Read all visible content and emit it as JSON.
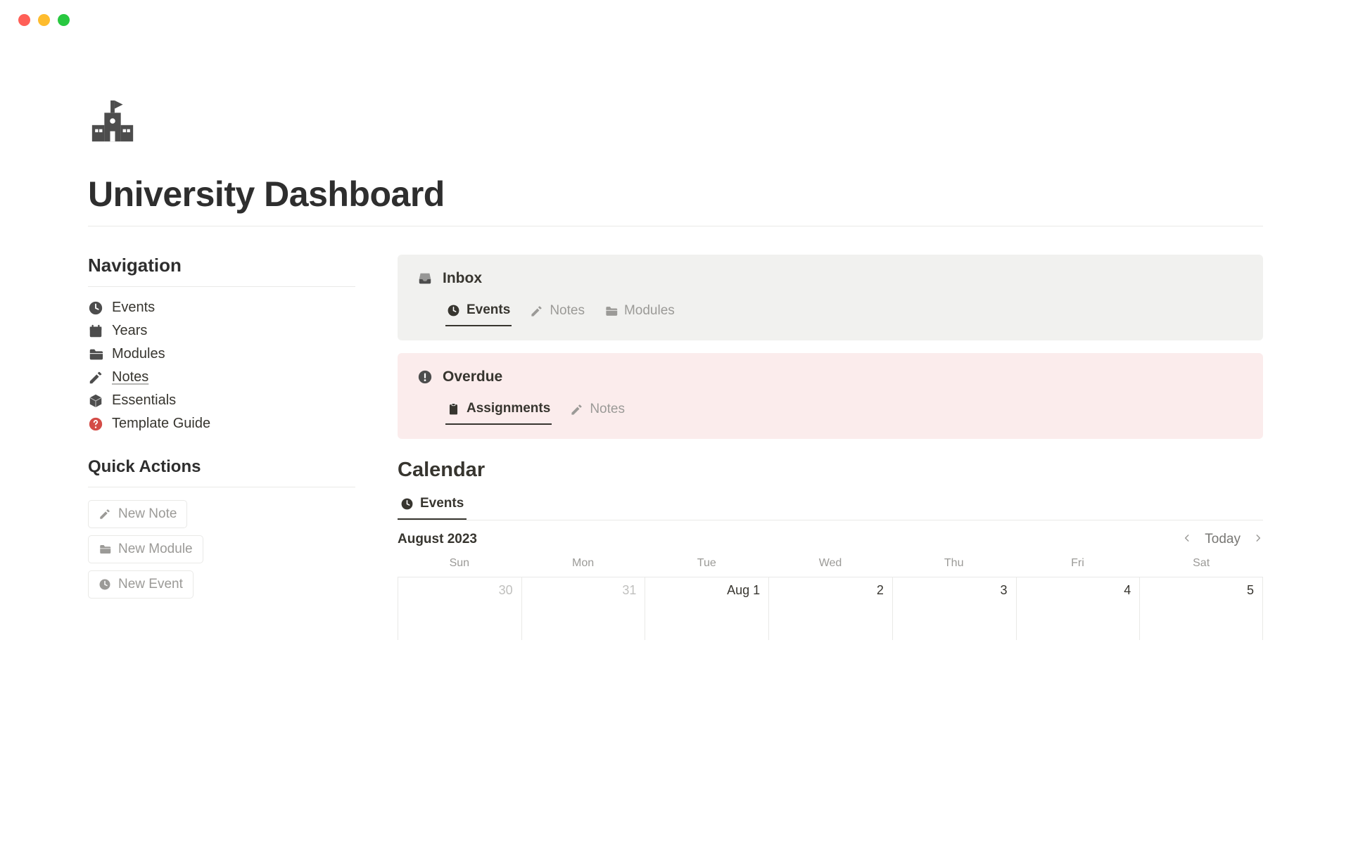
{
  "page": {
    "title": "University Dashboard"
  },
  "sidebar": {
    "nav_heading": "Navigation",
    "items": [
      {
        "icon": "clock",
        "label": "Events"
      },
      {
        "icon": "calendar",
        "label": "Years"
      },
      {
        "icon": "folder",
        "label": "Modules"
      },
      {
        "icon": "pencil",
        "label": "Notes",
        "underline": true
      },
      {
        "icon": "box",
        "label": "Essentials"
      },
      {
        "icon": "help",
        "label": "Template Guide",
        "icon_color": "red"
      }
    ],
    "qa_heading": "Quick Actions",
    "qa": [
      {
        "icon": "pencil",
        "label": "New Note"
      },
      {
        "icon": "folder",
        "label": "New Module"
      },
      {
        "icon": "clock",
        "label": "New Event"
      }
    ]
  },
  "inbox": {
    "title": "Inbox",
    "tabs": [
      {
        "icon": "clock",
        "label": "Events",
        "active": true
      },
      {
        "icon": "pencil",
        "label": "Notes"
      },
      {
        "icon": "folder",
        "label": "Modules"
      }
    ]
  },
  "overdue": {
    "title": "Overdue",
    "tabs": [
      {
        "icon": "clipboard",
        "label": "Assignments",
        "active": true
      },
      {
        "icon": "pencil",
        "label": "Notes"
      }
    ]
  },
  "calendar": {
    "heading": "Calendar",
    "tabs": [
      {
        "icon": "clock",
        "label": "Events",
        "active": true
      }
    ],
    "month_label": "August 2023",
    "today_label": "Today",
    "dow": [
      "Sun",
      "Mon",
      "Tue",
      "Wed",
      "Thu",
      "Fri",
      "Sat"
    ],
    "days": [
      {
        "label": "30",
        "other": true
      },
      {
        "label": "31",
        "other": true
      },
      {
        "label": "Aug 1"
      },
      {
        "label": "2"
      },
      {
        "label": "3"
      },
      {
        "label": "4"
      },
      {
        "label": "5"
      }
    ]
  }
}
